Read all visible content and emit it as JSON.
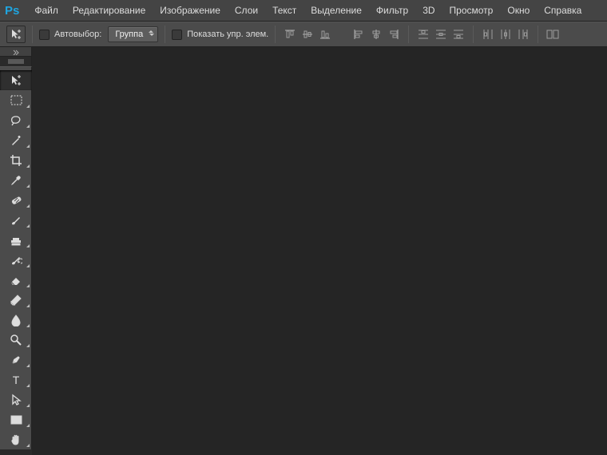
{
  "app": {
    "logo_p": "P",
    "logo_s": "s"
  },
  "menu": {
    "file": "Файл",
    "edit": "Редактирование",
    "image": "Изображение",
    "layers": "Слои",
    "text": "Текст",
    "select": "Выделение",
    "filter": "Фильтр",
    "threeD": "3D",
    "view": "Просмотр",
    "window": "Окно",
    "help": "Справка"
  },
  "options": {
    "auto_select_label": "Автовыбор:",
    "group_dropdown": "Группа",
    "show_transform_label": "Показать упр. элем."
  },
  "tools": {
    "active": "move"
  }
}
